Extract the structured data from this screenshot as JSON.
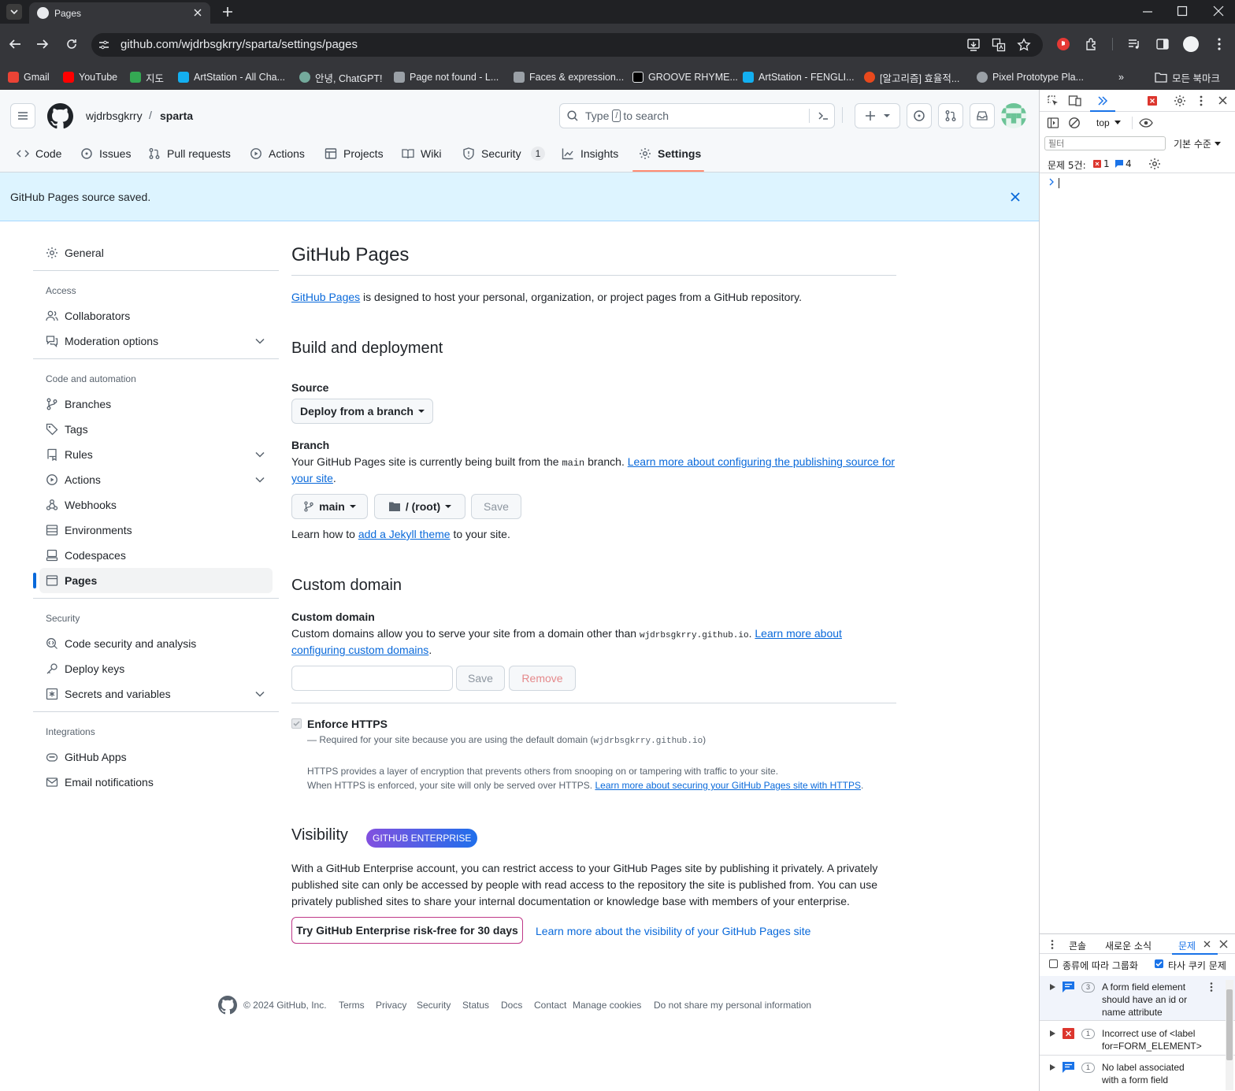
{
  "browser": {
    "tab_title": "Pages",
    "url": "github.com/wjdrbsgkrry/sparta/settings/pages",
    "bookmarks": [
      {
        "label": "Gmail",
        "color": "#ea4335"
      },
      {
        "label": "YouTube",
        "color": "#ff0000"
      },
      {
        "label": "지도",
        "color": "#34a853"
      },
      {
        "label": "ArtStation - All Cha...",
        "color": "#13aff0"
      },
      {
        "label": "안녕, ChatGPT!",
        "color": "#74aa9c"
      },
      {
        "label": "Page not found - L...",
        "color": "#9aa0a6"
      },
      {
        "label": "Faces & expression...",
        "color": "#9aa0a6"
      },
      {
        "label": "GROOVE RHYME...",
        "color": "#000000"
      },
      {
        "label": "ArtStation - FENGLI...",
        "color": "#13aff0"
      },
      {
        "label": "[알고리즘] 효율적...",
        "color": "#e8491d"
      },
      {
        "label": "Pixel Prototype Pla...",
        "color": "#9aa0a6"
      }
    ],
    "all_bookmarks": "모든 북마크"
  },
  "repo": {
    "owner": "wjdrbsgkrry",
    "separator": "/",
    "name": "sparta",
    "search_placeholder_pre": "Type",
    "search_key": "/",
    "search_placeholder_post": "to search"
  },
  "tabs": [
    {
      "label": "Code",
      "icon": "code-icon"
    },
    {
      "label": "Issues",
      "icon": "issue-icon"
    },
    {
      "label": "Pull requests",
      "icon": "pull-request-icon"
    },
    {
      "label": "Actions",
      "icon": "play-icon"
    },
    {
      "label": "Projects",
      "icon": "table-icon"
    },
    {
      "label": "Wiki",
      "icon": "book-icon"
    },
    {
      "label": "Security",
      "icon": "shield-icon",
      "count": "1"
    },
    {
      "label": "Insights",
      "icon": "graph-icon"
    },
    {
      "label": "Settings",
      "icon": "gear-icon",
      "selected": true
    }
  ],
  "flash": {
    "message": "GitHub Pages source saved."
  },
  "sidebar": {
    "general": "General",
    "access_heading": "Access",
    "access": [
      "Collaborators",
      "Moderation options"
    ],
    "code_heading": "Code and automation",
    "code": [
      "Branches",
      "Tags",
      "Rules",
      "Actions",
      "Webhooks",
      "Environments",
      "Codespaces",
      "Pages"
    ],
    "security_heading": "Security",
    "security": [
      "Code security and analysis",
      "Deploy keys",
      "Secrets and variables"
    ],
    "integrations_heading": "Integrations",
    "integrations": [
      "GitHub Apps",
      "Email notifications"
    ]
  },
  "main": {
    "title": "GitHub Pages",
    "intro_link": "GitHub Pages",
    "intro_text": " is designed to host your personal, organization, or project pages from a GitHub repository.",
    "build_heading": "Build and deployment",
    "source_label": "Source",
    "source_value": "Deploy from a branch",
    "branch_label": "Branch",
    "branch_text_1": "Your GitHub Pages site is currently being built from the ",
    "branch_code": "main",
    "branch_text_2": " branch. ",
    "branch_link_1": "Learn more about configuring the publishing source for",
    "branch_link_2": "your site",
    "branch_end": ".",
    "branch_select": "main",
    "folder_select": "/ (root)",
    "save": "Save",
    "jekyll_pre": "Learn how to ",
    "jekyll_link": "add a Jekyll theme",
    "jekyll_post": " to your site.",
    "custom_heading": "Custom domain",
    "custom_label": "Custom domain",
    "custom_text_1": "Custom domains allow you to serve your site from a domain other than ",
    "custom_code": "wjdrbsgkrry.github.io",
    "custom_text_2": ". ",
    "custom_link_1": "Learn more about",
    "custom_link_2": "configuring custom domains",
    "custom_end": ".",
    "custom_value": "",
    "custom_save": "Save",
    "custom_remove": "Remove",
    "https_label": "Enforce HTTPS",
    "https_checked": true,
    "https_req_1": "— Required for your site because you are using the default domain (",
    "https_req_code": "wjdrbsgkrry.github.io",
    "https_req_2": ")",
    "https_desc_1": "HTTPS provides a layer of encryption that prevents others from snooping on or tampering with traffic to your site.",
    "https_desc_2": "When HTTPS is enforced, your site will only be served over HTTPS. ",
    "https_link": "Learn more about securing your GitHub Pages site with HTTPS",
    "https_end": ".",
    "visibility_heading": "Visibility",
    "enterprise_badge": "GITHUB ENTERPRISE",
    "visibility_text_1": "With a GitHub Enterprise account, you can restrict access to your GitHub Pages site by publishing it privately. A privately",
    "visibility_text_2": "published site can only be accessed by people with read access to the repository the site is published from. You can use",
    "visibility_text_3": "privately published sites to share your internal documentation or knowledge base with members of your enterprise.",
    "try_button": "Try GitHub Enterprise risk-free for 30 days",
    "visibility_link": "Learn more about the visibility of your GitHub Pages site"
  },
  "footer": {
    "copyright": "© 2024 GitHub, Inc.",
    "links": [
      "Terms",
      "Privacy",
      "Security",
      "Status",
      "Docs",
      "Contact",
      "Manage cookies",
      "Do not share my personal information"
    ]
  },
  "devtools": {
    "context": "top",
    "filter_placeholder": "필터",
    "level": "기본 수준",
    "issues_summary": "문제 5건:",
    "error_count": "1",
    "info_count": "4",
    "drawer_tabs": [
      "콘솔",
      "새로운 소식",
      "문제"
    ],
    "group_by_kind": "종류에 따라 그룹화",
    "third_party": "타사 쿠키 문제",
    "issues": [
      {
        "count": "3",
        "kind": "info",
        "lines": [
          "A form field element",
          "should have an id or",
          "name attribute"
        ]
      },
      {
        "count": "1",
        "kind": "error",
        "lines": [
          "Incorrect use of <label",
          "for=FORM_ELEMENT>"
        ]
      },
      {
        "count": "1",
        "kind": "info",
        "lines": [
          "No label associated",
          "with a form field"
        ]
      }
    ]
  },
  "colors": {
    "accent": "#0969da",
    "flash_bg": "#ddf4ff",
    "selected_tab_underline": "#fd8c73",
    "enterprise_badge": "#8250df"
  }
}
